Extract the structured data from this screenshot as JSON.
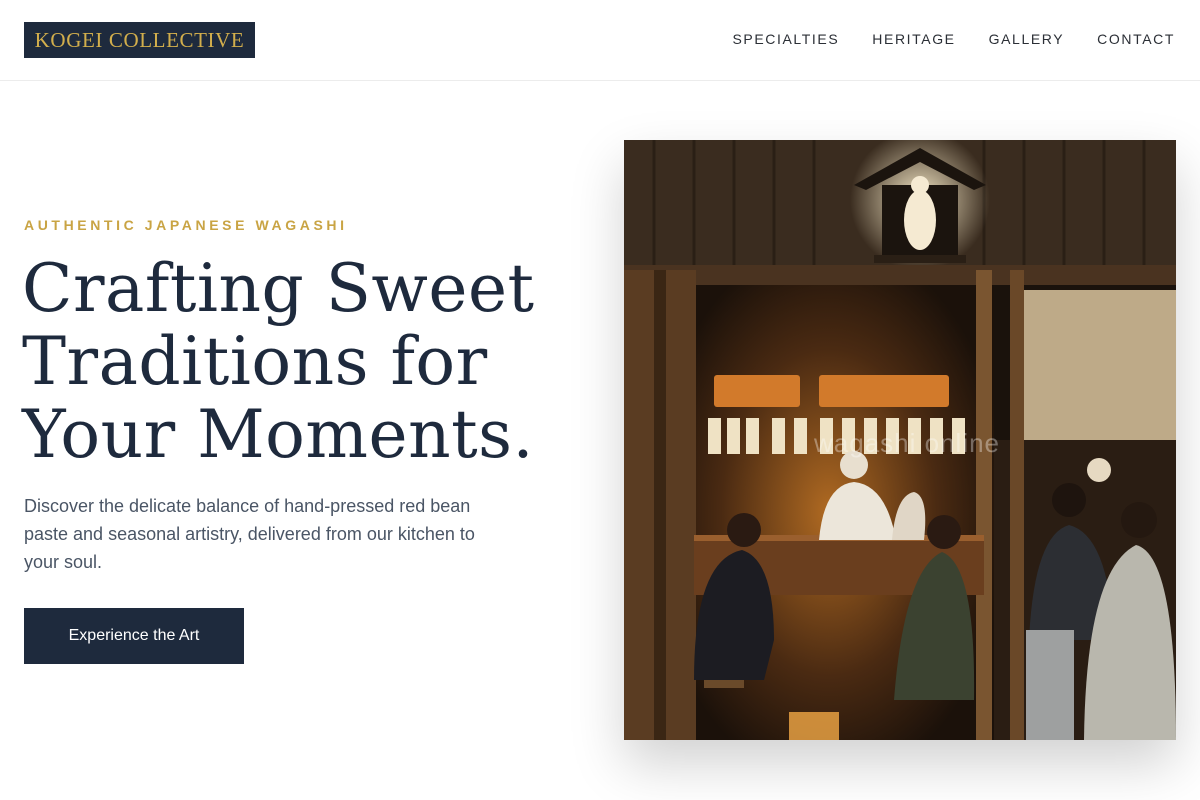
{
  "brand": {
    "logo_text": "KOGEI COLLECTIVE"
  },
  "nav": {
    "items": [
      {
        "label": "SPECIALTIES"
      },
      {
        "label": "HERITAGE"
      },
      {
        "label": "GALLERY"
      },
      {
        "label": "CONTACT"
      }
    ]
  },
  "hero": {
    "eyebrow": "AUTHENTIC JAPANESE WAGASHI",
    "headline_line1": "Crafting Sweet",
    "headline_line2": "Traditions for",
    "headline_line3": "Your Moments.",
    "subtext": "Discover the delicate balance of hand-pressed red bean paste and seasonal artistry, delivered from our kitchen to your soul.",
    "cta_label": "Experience the Art"
  },
  "image": {
    "alt": "Warm-lit Japanese eatery interior with diners at a counter and chefs preparing food",
    "watermark_text": "wagashi online"
  },
  "colors": {
    "navy": "#1e2a3d",
    "gold": "#d2ae4c",
    "text_muted": "#4a5565"
  }
}
